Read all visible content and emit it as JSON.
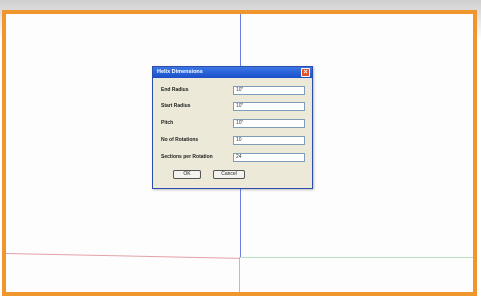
{
  "dialog": {
    "title": "Helix Dimensions",
    "close": "×",
    "fields": [
      {
        "label": "End Radius",
        "value": "10\""
      },
      {
        "label": "Start Radius",
        "value": "10\""
      },
      {
        "label": "Pitch",
        "value": "10\""
      },
      {
        "label": "No of Rotations",
        "value": "10"
      },
      {
        "label": "Sections per Rotation",
        "value": "24"
      }
    ],
    "ok_label": "OK",
    "cancel_label": "Cancel"
  },
  "colors": {
    "frame": "#f0962e",
    "axis_blue": "#6f7fe0",
    "axis_red": "#e3a0a8",
    "axis_green": "#98d3a3",
    "titlebar": "#2a5fd6",
    "dialog_bg": "#ece9d8"
  }
}
